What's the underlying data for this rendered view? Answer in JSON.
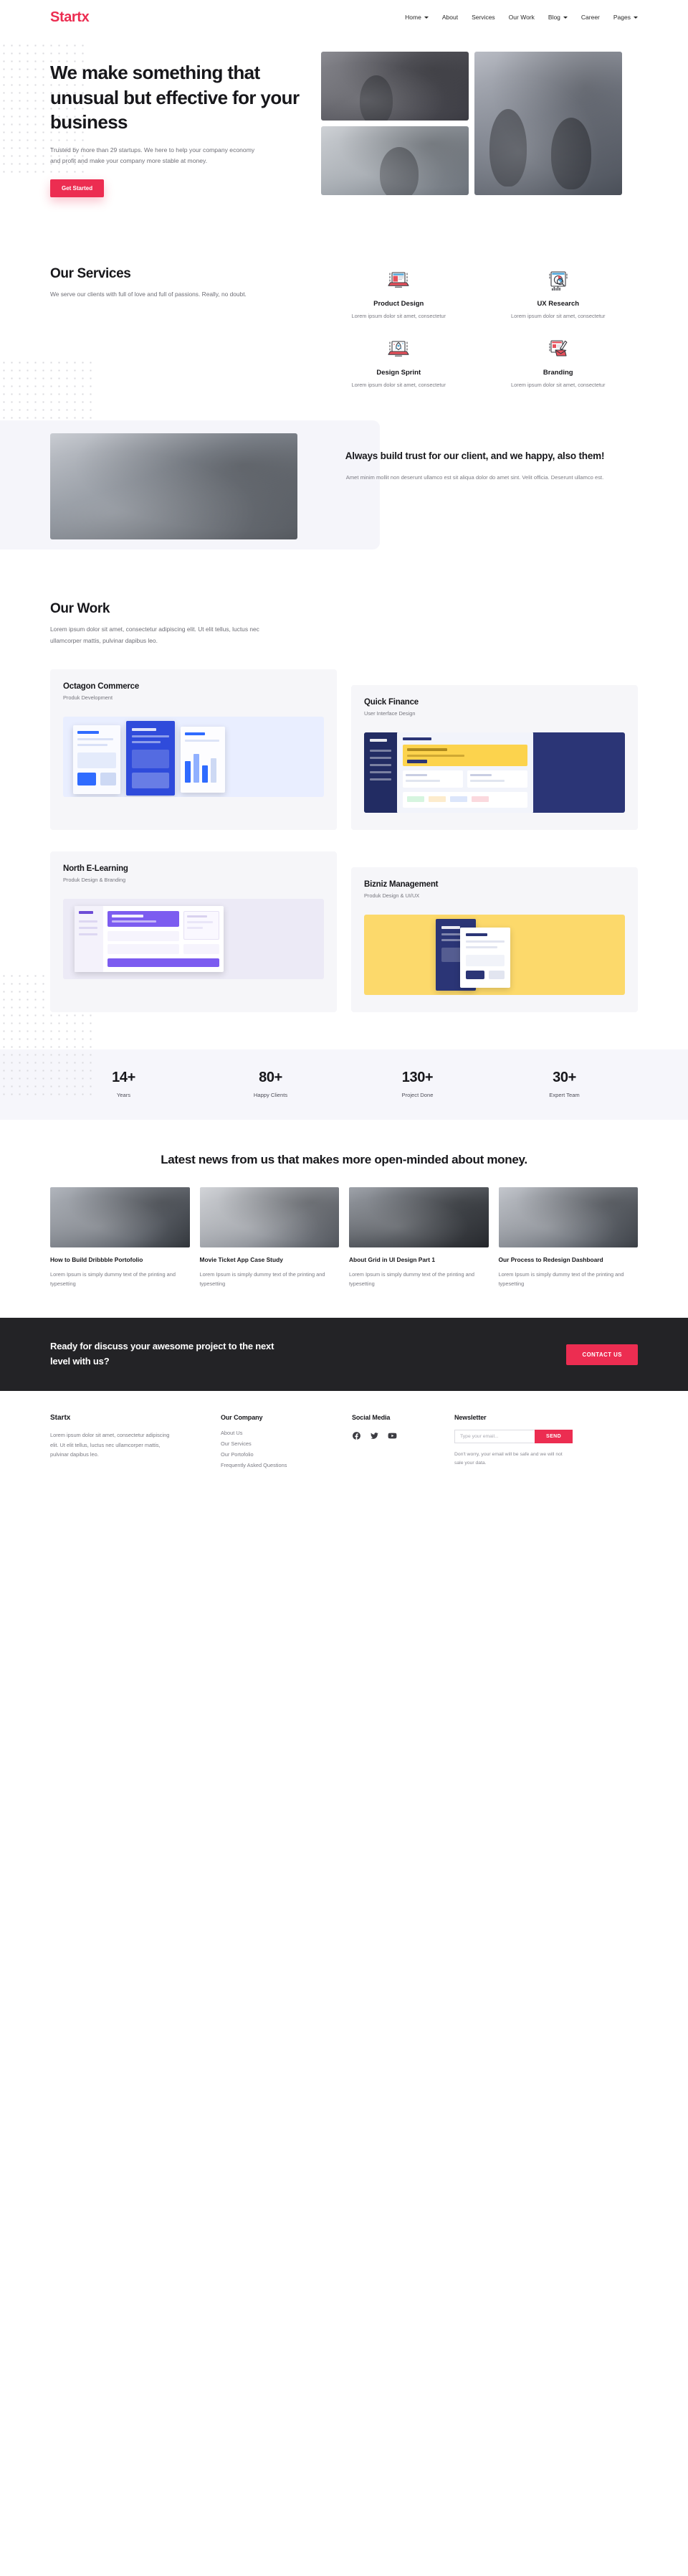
{
  "brand": {
    "name": "Startx",
    "accent": "#ec2d51",
    "dark": "#232326"
  },
  "nav": {
    "items": [
      {
        "label": "Home",
        "caret": true
      },
      {
        "label": "About",
        "caret": false
      },
      {
        "label": "Services",
        "caret": false
      },
      {
        "label": "Our Work",
        "caret": false
      },
      {
        "label": "Blog",
        "caret": true
      },
      {
        "label": "Career",
        "caret": false
      },
      {
        "label": "Pages",
        "caret": true
      }
    ]
  },
  "hero": {
    "title": "We make something that unusual but effective for your business",
    "subtitle": "Trusted by more than 29 startups. We here to help  your company economy and profit and make your company  more stable at money.",
    "cta": "Get Started"
  },
  "services": {
    "title": "Our Services",
    "subtitle": "We serve our clients with full of love and full of passions. Really, no doubt.",
    "items": [
      {
        "icon": "laptop-design-icon",
        "name": "Product Design",
        "desc": "Lorem ipsum dolor sit amet, consectetur"
      },
      {
        "icon": "browser-research-icon",
        "name": "UX Research",
        "desc": "Lorem ipsum dolor sit amet, consectetur"
      },
      {
        "icon": "rocket-laptop-icon",
        "name": "Design Sprint",
        "desc": "Lorem ipsum dolor sit amet, consectetur"
      },
      {
        "icon": "branding-envelope-icon",
        "name": "Branding",
        "desc": "Lorem ipsum dolor sit amet, consectetur"
      }
    ]
  },
  "trust": {
    "title": "Always build trust for our client, and we happy, also them!",
    "desc": "Amet minim mollit non deserunt ullamco est sit aliqua dolor do amet sint. Velit officia. Deserunt ullamco est."
  },
  "work": {
    "title": "Our Work",
    "subtitle": "Lorem ipsum dolor sit amet, consectetur adipiscing elit. Ut elit tellus, luctus nec ullamcorper mattis, pulvinar dapibus leo.",
    "items": [
      {
        "title": "Octagon Commerce",
        "category": "Produk Development"
      },
      {
        "title": "Quick Finance",
        "category": "User Interface Design"
      },
      {
        "title": "North E-Learning",
        "category": "Produk Design & Branding"
      },
      {
        "title": "Bizniz Management",
        "category": "Produk Design & UI/UX"
      }
    ]
  },
  "stats": [
    {
      "value": "14+",
      "label": "Years"
    },
    {
      "value": "80+",
      "label": "Happy Clients"
    },
    {
      "value": "130+",
      "label": "Project Done"
    },
    {
      "value": "30+",
      "label": "Expert Team"
    }
  ],
  "news": {
    "title": "Latest news from us that makes more open-minded about money.",
    "posts": [
      {
        "title": "How to Build Dribbble Portofolio",
        "excerpt": "Lorem Ipsum is simply dummy text of the printing and typesetting"
      },
      {
        "title": "Movie Ticket App Case Study",
        "excerpt": "Lorem Ipsum is simply dummy text of the printing and typesetting"
      },
      {
        "title": "About Grid in UI Design Part 1",
        "excerpt": "Lorem Ipsum is simply dummy text of the printing and typesetting"
      },
      {
        "title": "Our Process to Redesign Dashboard",
        "excerpt": "Lorem Ipsum is simply dummy text of the printing and typesetting"
      }
    ]
  },
  "cta": {
    "title": "Ready for discuss your awesome project to the next level with us?",
    "button": "CONTACT US"
  },
  "footer": {
    "brand": "Startx",
    "about": "Lorem ipsum dolor sit amet, consectetur adipiscing elit. Ut elit tellus, luctus nec ullamcorper mattis, pulvinar dapibus leo.",
    "company": {
      "heading": "Our Company",
      "links": [
        "About Us",
        "Our Services",
        "Our Portofolio",
        "Frequently Asked Questions"
      ]
    },
    "social": {
      "heading": "Social Media",
      "items": [
        "facebook-icon",
        "twitter-icon",
        "youtube-icon"
      ]
    },
    "newsletter": {
      "heading": "Newsletter",
      "placeholder": "Type your email...",
      "value": "",
      "button": "SEND",
      "note": "Don't worry, your email will be safe and we will not sale your data."
    }
  }
}
